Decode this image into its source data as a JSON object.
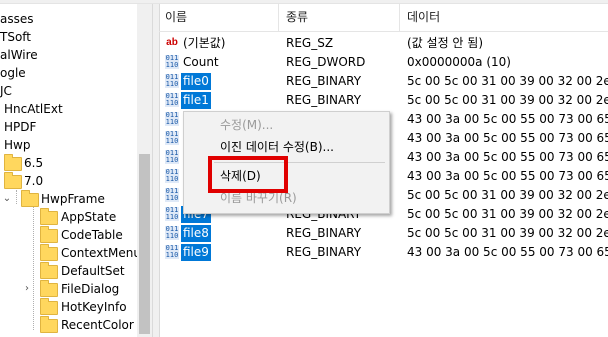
{
  "tree": {
    "items": [
      {
        "label": "asses",
        "name": "tree-item-classes"
      },
      {
        "label": "TSoft",
        "name": "tree-item-tsoft"
      },
      {
        "label": "alWire",
        "name": "tree-item-alwire"
      },
      {
        "label": "ogle",
        "name": "tree-item-google"
      },
      {
        "label": "JC",
        "name": "tree-item-jc"
      },
      {
        "label": "HncAtlExt",
        "name": "tree-item-hncatlext"
      },
      {
        "label": "HPDF",
        "name": "tree-item-hpdf"
      },
      {
        "label": "Hwp",
        "name": "tree-item-hwp"
      },
      {
        "label": "6.5",
        "name": "tree-item-6-5"
      },
      {
        "label": "7.0",
        "name": "tree-item-7-0"
      },
      {
        "label": "HwpFrame",
        "name": "tree-item-hwpframe"
      },
      {
        "label": "AppState",
        "name": "tree-item-appstate"
      },
      {
        "label": "CodeTable",
        "name": "tree-item-codetable"
      },
      {
        "label": "ContextMenu",
        "name": "tree-item-contextmenu"
      },
      {
        "label": "DefaultSet",
        "name": "tree-item-defaultset"
      },
      {
        "label": "FileDialog",
        "name": "tree-item-filedialog"
      },
      {
        "label": "HotKeyInfo",
        "name": "tree-item-hotkeyinfo"
      },
      {
        "label": "RecentColor",
        "name": "tree-item-recentcolor"
      }
    ]
  },
  "list": {
    "headers": {
      "name": "이름",
      "type": "종류",
      "data": "데이터"
    },
    "rows": [
      {
        "icon": "ab",
        "name": "(기본값)",
        "type": "REG_SZ",
        "data": "(값 설정 안 됨)"
      },
      {
        "icon": "bin",
        "name": "Count",
        "type": "REG_DWORD",
        "data": "0x0000000a (10)"
      },
      {
        "icon": "bin",
        "name": "file0",
        "type": "REG_BINARY",
        "data": "5c 00 5c 00 31 00 39 00 32 00 2e 0"
      },
      {
        "icon": "bin",
        "name": "file1",
        "type": "REG_BINARY",
        "data": "5c 00 5c 00 31 00 39 00 32 00 2e 0"
      },
      {
        "icon": "bin",
        "name": "",
        "type": "REG_BINARY",
        "data": "43 00 3a 00 5c 00 55 00 73 00 65 0"
      },
      {
        "icon": "bin",
        "name": "",
        "type": "REG_BINARY",
        "data": "43 00 3a 00 5c 00 55 00 73 00 65 0"
      },
      {
        "icon": "bin",
        "name": "",
        "type": "REG_BINARY",
        "data": "43 00 3a 00 5c 00 55 00 73 00 65 0"
      },
      {
        "icon": "bin",
        "name": "",
        "type": "REG_BINARY",
        "data": "43 00 3a 00 5c 00 55 00 73 00 65 0"
      },
      {
        "icon": "bin",
        "name": "",
        "type": "REG_BINARY",
        "data": "5c 00 5c 00 31 00 39 00 32 00 2e 0"
      },
      {
        "icon": "bin",
        "name": "file7",
        "type": "REG_BINARY",
        "data": "5c 00 5c 00 31 00 39 00 32 00 2e 0"
      },
      {
        "icon": "bin",
        "name": "file8",
        "type": "REG_BINARY",
        "data": "5c 00 5c 00 31 00 39 00 32 00 2e 0"
      },
      {
        "icon": "bin",
        "name": "file9",
        "type": "REG_BINARY",
        "data": "43 00 3a 00 5c 00 55 00 73 00 65 0"
      }
    ],
    "icon_text": {
      "ab": "ab",
      "bin": "011\n110"
    }
  },
  "context_menu": {
    "modify": "수정(M)...",
    "modify_binary": "이진 데이터 수정(B)...",
    "delete": "삭제(D)",
    "rename": "이름 바꾸기(R)"
  },
  "colors": {
    "selection": "#0078d7",
    "highlight_box": "#e00000",
    "folder": "#ffd75e"
  }
}
